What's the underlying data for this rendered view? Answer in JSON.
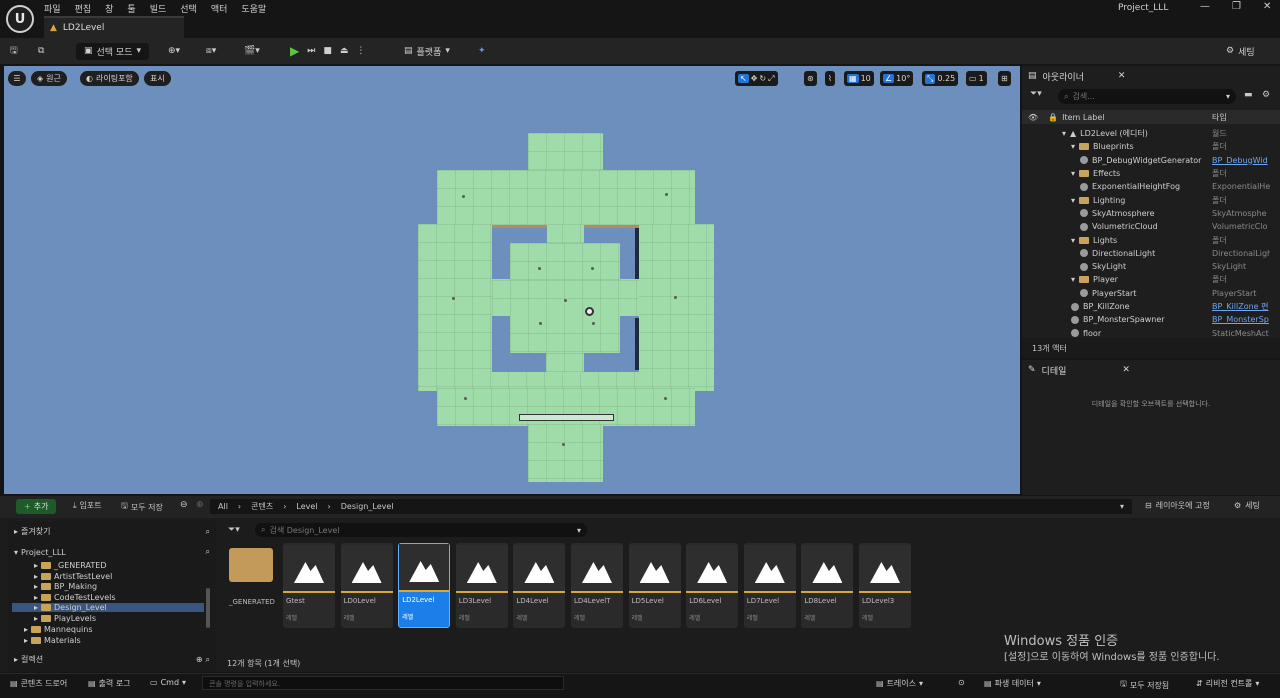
{
  "menu": [
    "파일",
    "편집",
    "창",
    "툴",
    "빌드",
    "선택",
    "액터",
    "도움말"
  ],
  "project_name": "Project_LLL",
  "level_tab": "LD2Level",
  "toolbar": {
    "select_mode": "선택 모드",
    "platforms": "플랫폼",
    "settings": "세팅"
  },
  "viewport": {
    "perspective": "원근",
    "lighting": "라이팅포함",
    "show": "표시",
    "grid": "10",
    "rotation": "10°",
    "scale": "0.25",
    "camera": "1"
  },
  "outliner": {
    "title": "아웃라이너",
    "search_placeholder": "검색...",
    "col_label": "Item Label",
    "col_type": "타입",
    "count": "13개 액터",
    "rows": [
      {
        "label": "LD2Level (에디터)",
        "type": "월드",
        "kind": "world",
        "indent": 0
      },
      {
        "label": "Blueprints",
        "type": "폴더",
        "kind": "folder",
        "indent": 1
      },
      {
        "label": "BP_DebugWidgetGenerator",
        "type": "BP_DebugWid",
        "kind": "actor",
        "indent": 2,
        "link": true
      },
      {
        "label": "Effects",
        "type": "폴더",
        "kind": "folder",
        "indent": 1
      },
      {
        "label": "ExponentialHeightFog",
        "type": "ExponentialHe",
        "kind": "actor",
        "indent": 2
      },
      {
        "label": "Lighting",
        "type": "폴더",
        "kind": "folder",
        "indent": 1
      },
      {
        "label": "SkyAtmosphere",
        "type": "SkyAtmosphe",
        "kind": "actor",
        "indent": 2
      },
      {
        "label": "VolumetricCloud",
        "type": "VolumetricClo",
        "kind": "actor",
        "indent": 2
      },
      {
        "label": "Lights",
        "type": "폴더",
        "kind": "folder",
        "indent": 1
      },
      {
        "label": "DirectionalLight",
        "type": "DirectionalLigh",
        "kind": "actor",
        "indent": 2
      },
      {
        "label": "SkyLight",
        "type": "SkyLight",
        "kind": "actor",
        "indent": 2
      },
      {
        "label": "Player",
        "type": "폴더",
        "kind": "folder",
        "indent": 1
      },
      {
        "label": "PlayerStart",
        "type": "PlayerStart",
        "kind": "actor",
        "indent": 2
      },
      {
        "label": "BP_KillZone",
        "type": "BP_KillZone 편",
        "kind": "actor",
        "indent": 1,
        "link": true
      },
      {
        "label": "BP_MonsterSpawner",
        "type": "BP_MonsterSp",
        "kind": "actor",
        "indent": 1,
        "link": true
      },
      {
        "label": "floor",
        "type": "StaticMeshAct",
        "kind": "actor",
        "indent": 1
      }
    ]
  },
  "details": {
    "title": "디테일",
    "empty_text": "디테일을 확인할 오브젝트를 선택합니다."
  },
  "content_browser": {
    "add": "추가",
    "import": "임포트",
    "save_all": "모두 저장",
    "path": [
      "All",
      "콘텐츠",
      "Level",
      "Design_Level"
    ],
    "lock_layout": "레이아웃에 고정",
    "settings": "세팅",
    "favorites": "즐겨찾기",
    "root": "Project_LLL",
    "tree": [
      "_GENERATED",
      "ArtistTestLevel",
      "BP_Making",
      "CodeTestLevels",
      "Design_Level",
      "PlayLevels",
      "Mannequins",
      "Materials"
    ],
    "collections": "컬렉션",
    "search_placeholder": "검색 Design_Level",
    "folder": "_GENERATED",
    "assets": [
      {
        "name": "Gtest",
        "type": "레벨"
      },
      {
        "name": "LD0Level",
        "type": "레벨"
      },
      {
        "name": "LD2Level",
        "type": "레벨"
      },
      {
        "name": "LD3Level",
        "type": "레벨"
      },
      {
        "name": "LD4Level",
        "type": "레벨"
      },
      {
        "name": "LD4LevelT",
        "type": "레벨"
      },
      {
        "name": "LD5Level",
        "type": "레벨"
      },
      {
        "name": "LD6Level",
        "type": "레벨"
      },
      {
        "name": "LD7Level",
        "type": "레벨"
      },
      {
        "name": "LD8Level",
        "type": "레벨"
      },
      {
        "name": "LDLevel3",
        "type": "레벨"
      }
    ],
    "item_count": "12개 항목 (1개 선택)"
  },
  "watermark": {
    "line1": "Windows 정품 인증",
    "line2": "[설정]으로 이동하여 Windows를 정품 인증합니다."
  },
  "status": {
    "content_drawer": "콘텐츠 드로어",
    "output_log": "출력 로그",
    "cmd": "Cmd",
    "console_placeholder": "콘솔 명령을 입력하세요.",
    "trace": "트레이스",
    "derived_data": "파생 데이터",
    "all_saved": "모두 저장됨",
    "revision": "리비전 컨트롤"
  }
}
